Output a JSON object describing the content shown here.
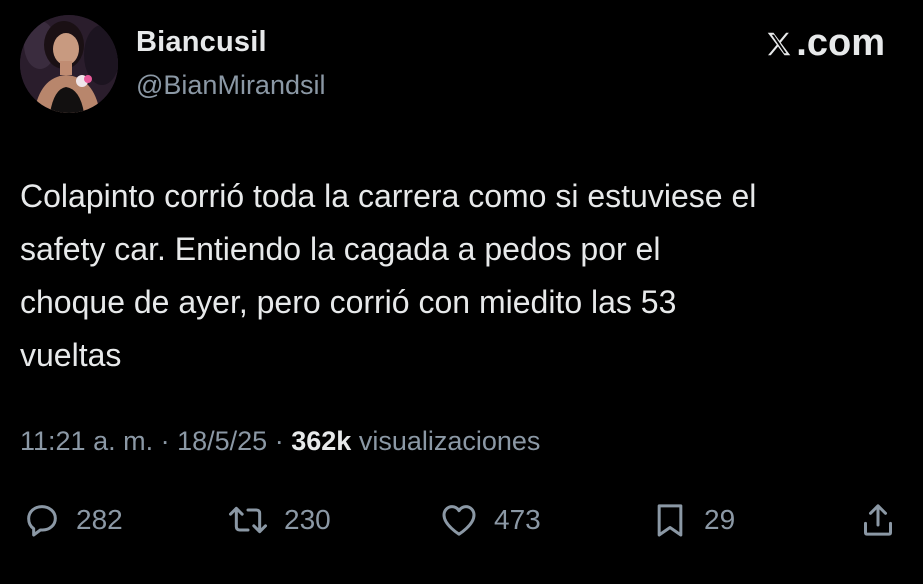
{
  "author": {
    "display_name": "Biancusil",
    "handle": "@BianMirandsil"
  },
  "brand": {
    "logo_text": ".com"
  },
  "tweet": {
    "text": "Colapinto corrió toda la carrera como si estuviese el\nsafety car. Entiendo la cagada a pedos por el\nchoque de ayer, pero corrió con miedito las 53\nvueltas",
    "time": "11:21 a. m.",
    "date": "18/5/25",
    "separator": "·",
    "views_count": "362k",
    "views_label": "visualizaciones"
  },
  "actions": {
    "replies": "282",
    "reposts": "230",
    "likes": "473",
    "bookmarks": "29"
  },
  "colors": {
    "background": "#000000",
    "primary_text": "#e7e9ea",
    "secondary_text": "#8b98a5"
  },
  "icons": [
    "reply-icon",
    "repost-icon",
    "like-icon",
    "bookmark-icon",
    "share-icon",
    "x-logo-icon"
  ]
}
